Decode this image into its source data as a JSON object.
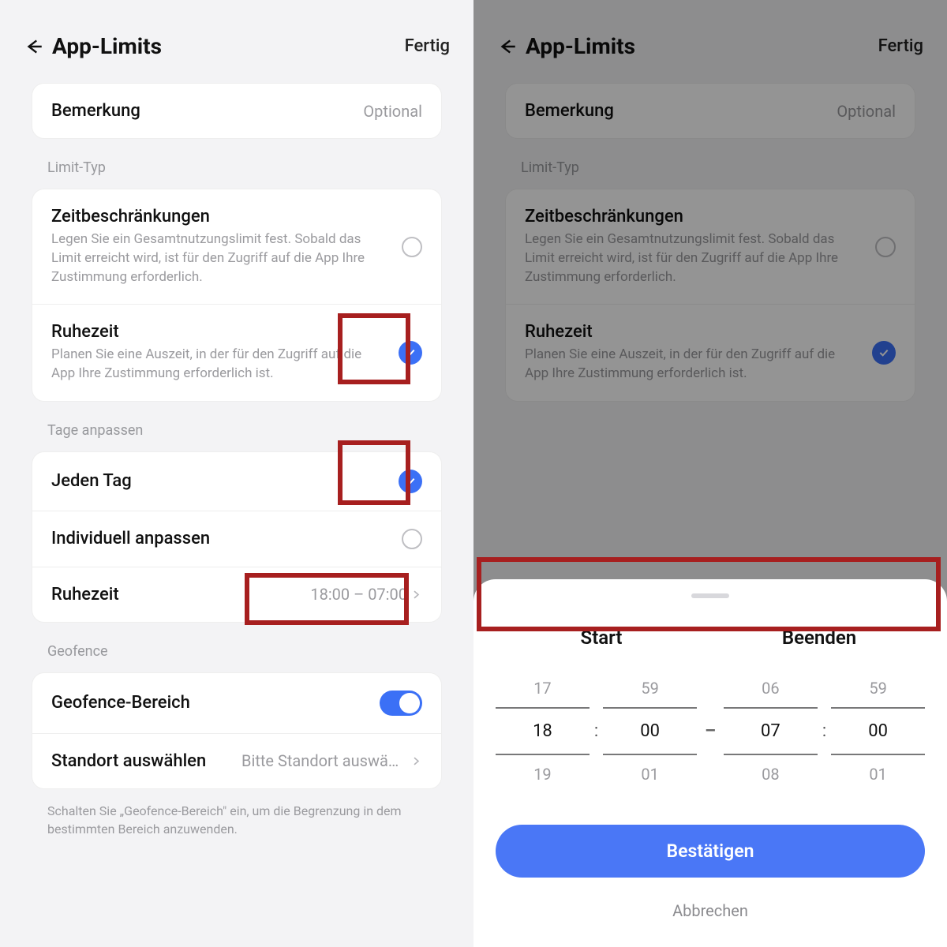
{
  "header": {
    "title": "App-Limits",
    "done": "Fertig"
  },
  "note_row": {
    "label": "Bemerkung",
    "placeholder": "Optional"
  },
  "limit_type": {
    "section": "Limit-Typ",
    "time_title": "Zeitbeschränkungen",
    "time_desc": "Legen Sie ein Gesamtnutzungslimit fest. Sobald das Limit erreicht wird, ist für den Zugriff auf die App Ihre Zustimmung erforderlich.",
    "quiet_title": "Ruhezeit",
    "quiet_desc": "Planen Sie eine Auszeit, in der für den Zugriff auf die App Ihre Zustimmung erforderlich ist."
  },
  "days": {
    "section": "Tage anpassen",
    "every_day": "Jeden Tag",
    "custom": "Individuell anpassen",
    "quiet_label": "Ruhezeit",
    "quiet_value": "18:00 – 07:00"
  },
  "geofence": {
    "section": "Geofence",
    "area_label": "Geofence-Bereich",
    "location_label": "Standort auswählen",
    "location_value": "Bitte Standort auswäh…",
    "footnote": "Schalten Sie „Geofence-Bereich\" ein, um die Begrenzung in dem bestimmten Bereich anzuwenden."
  },
  "picker": {
    "start": "Start",
    "end": "Beenden",
    "start_h_prev": "17",
    "start_h": "18",
    "start_h_next": "19",
    "start_m_prev": "59",
    "start_m": "00",
    "start_m_next": "01",
    "end_h_prev": "06",
    "end_h": "07",
    "end_h_next": "08",
    "end_m_prev": "59",
    "end_m": "00",
    "end_m_next": "01",
    "confirm": "Bestätigen",
    "cancel": "Abbrechen"
  }
}
